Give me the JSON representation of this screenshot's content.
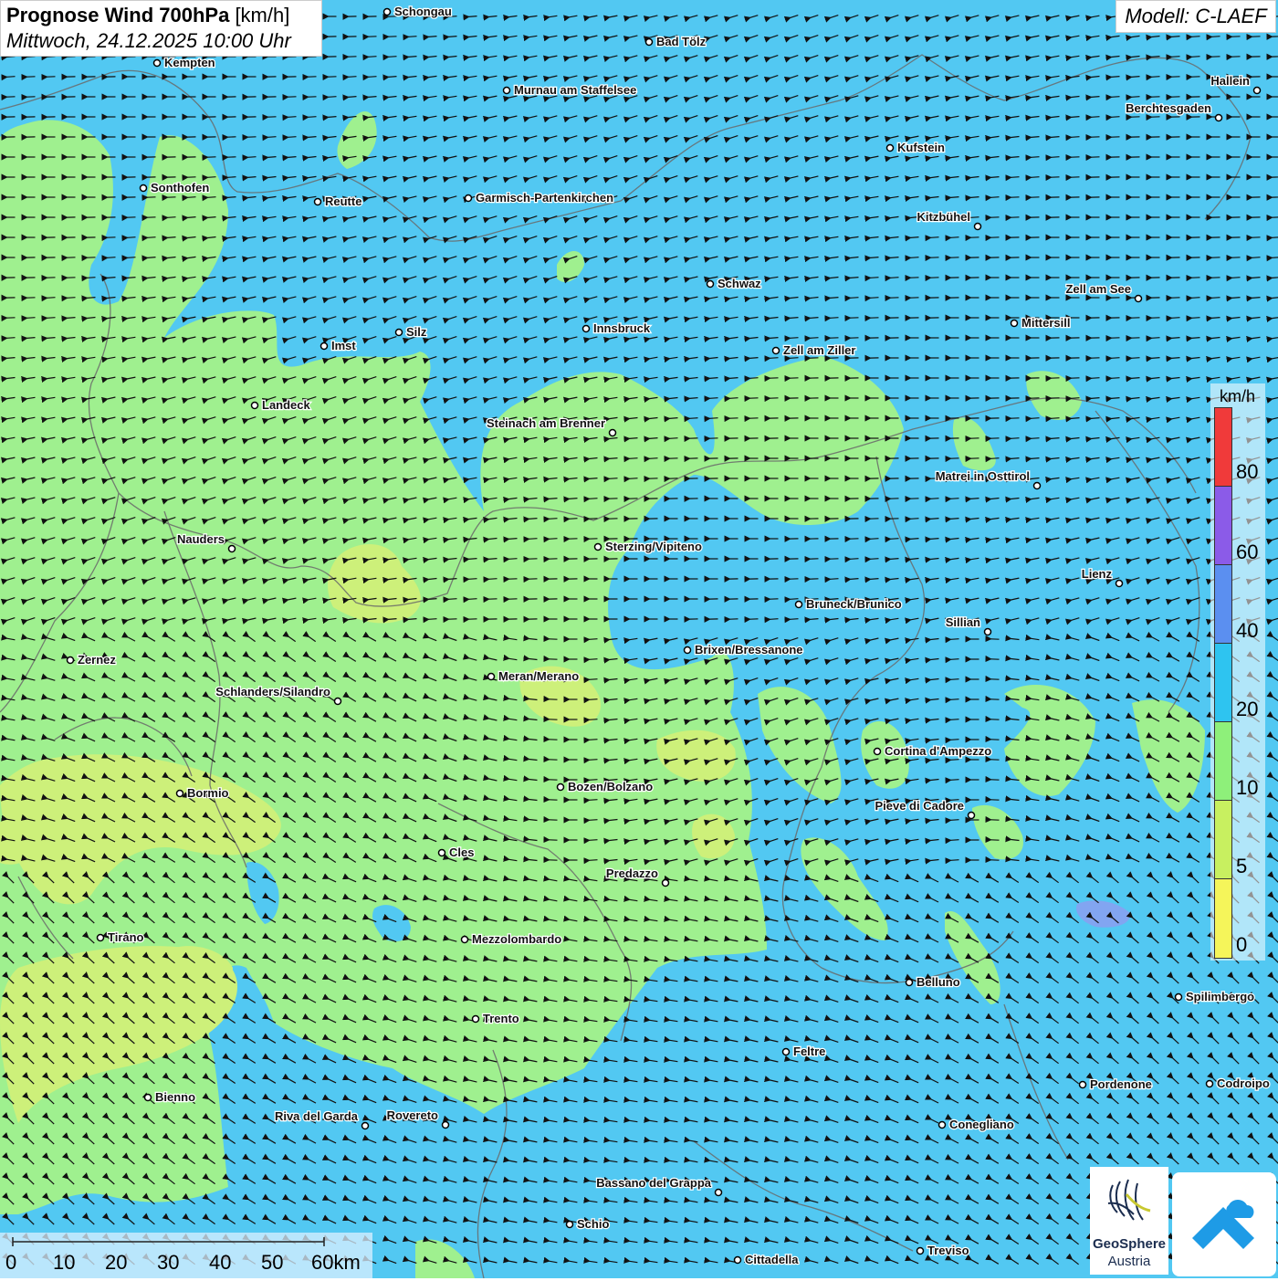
{
  "header": {
    "title_bold": "Prognose Wind 700hPa",
    "title_unit": "[km/h]",
    "date": "Mittwoch, 24.12.2025 10:00 Uhr",
    "model": "Modell: C-LAEF"
  },
  "legend": {
    "unit": "km/h",
    "labels": [
      "80",
      "60",
      "40",
      "20",
      "10",
      "5",
      "0"
    ],
    "colors": [
      "#f03a3a",
      "#8b5be8",
      "#5b8ff0",
      "#2ec4f0",
      "#8ef07a",
      "#c8f060",
      "#f5f55a"
    ]
  },
  "scale": {
    "labels": [
      "0",
      "10",
      "20",
      "30",
      "40",
      "50",
      "60km"
    ]
  },
  "logos": {
    "geosphere_line1": "GeoSphere",
    "geosphere_line2": "Austria"
  },
  "colors": {
    "background": "#52c8f2",
    "light_green": "#9ff08f",
    "yellow_green": "#cdf07a"
  },
  "cities": [
    {
      "name": "Schongau"
    },
    {
      "name": "Bad Tölz"
    },
    {
      "name": "Kempten"
    },
    {
      "name": "Murnau am Staffelsee"
    },
    {
      "name": "Hallein"
    },
    {
      "name": "Berchtesgaden"
    },
    {
      "name": "Kufstein"
    },
    {
      "name": "Sonthofen"
    },
    {
      "name": "Reutte"
    },
    {
      "name": "Garmisch-Partenkirchen"
    },
    {
      "name": "Kitzbühel"
    },
    {
      "name": "Schwaz"
    },
    {
      "name": "Zell am See"
    },
    {
      "name": "Mittersill"
    },
    {
      "name": "Silz"
    },
    {
      "name": "Innsbruck"
    },
    {
      "name": "Imst"
    },
    {
      "name": "Zell am Ziller"
    },
    {
      "name": "Landeck"
    },
    {
      "name": "Steinach am Brenner"
    },
    {
      "name": "Matrei in Osttirol"
    },
    {
      "name": "Nauders"
    },
    {
      "name": "Sterzing/Vipiteno"
    },
    {
      "name": "Lienz"
    },
    {
      "name": "Bruneck/Brunico"
    },
    {
      "name": "Sillian"
    },
    {
      "name": "Zernez"
    },
    {
      "name": "Brixen/Bressanone"
    },
    {
      "name": "Meran/Merano"
    },
    {
      "name": "Schlanders/Silandro"
    },
    {
      "name": "Cortina d'Ampezzo"
    },
    {
      "name": "Bozen/Bolzano"
    },
    {
      "name": "Bormio"
    },
    {
      "name": "Pieve di Cadore"
    },
    {
      "name": "Cles"
    },
    {
      "name": "Predazzo"
    },
    {
      "name": "Tirano"
    },
    {
      "name": "Mezzolombardo"
    },
    {
      "name": "Belluno"
    },
    {
      "name": "Spilimbergo"
    },
    {
      "name": "Trento"
    },
    {
      "name": "Feltre"
    },
    {
      "name": "Pordenone"
    },
    {
      "name": "Codroipo"
    },
    {
      "name": "Bienno"
    },
    {
      "name": "Riva del Garda"
    },
    {
      "name": "Rovereto"
    },
    {
      "name": "Conegliano"
    },
    {
      "name": "Bassano del Grappa"
    },
    {
      "name": "Schio"
    },
    {
      "name": "Treviso"
    },
    {
      "name": "Cittadella"
    }
  ]
}
